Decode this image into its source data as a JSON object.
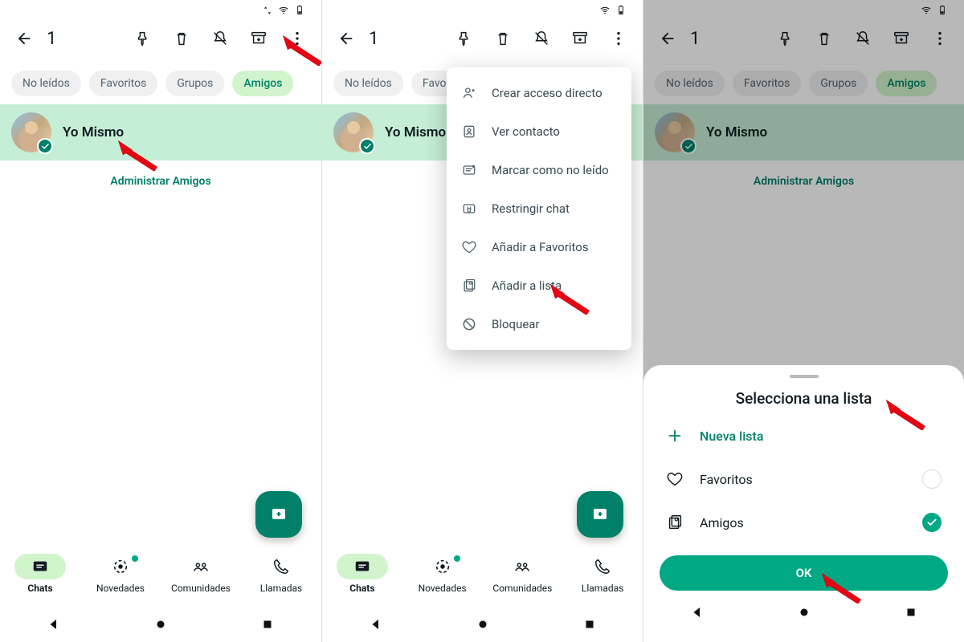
{
  "status": {
    "wifi": true,
    "battery": true
  },
  "appbar": {
    "count": "1",
    "icons": [
      "back",
      "pin",
      "delete",
      "mute",
      "archive",
      "more"
    ]
  },
  "chips": [
    {
      "label": "No leídos",
      "active": false
    },
    {
      "label": "Favoritos",
      "active": false
    },
    {
      "label": "Grupos",
      "active": false
    },
    {
      "label": "Amigos",
      "active": true
    }
  ],
  "chat": {
    "name": "Yo Mismo"
  },
  "manage": "Administrar Amigos",
  "bnav": [
    {
      "label": "Chats",
      "icon": "chat",
      "active": true
    },
    {
      "label": "Novedades",
      "icon": "status",
      "dot": true
    },
    {
      "label": "Comunidades",
      "icon": "communities"
    },
    {
      "label": "Llamadas",
      "icon": "calls"
    }
  ],
  "menu": [
    {
      "icon": "person-add",
      "label": "Crear acceso directo"
    },
    {
      "icon": "contact",
      "label": "Ver contacto"
    },
    {
      "icon": "unread",
      "label": "Marcar como no leído"
    },
    {
      "icon": "restrict",
      "label": "Restringir chat"
    },
    {
      "icon": "heart",
      "label": "Añadir a Favoritos"
    },
    {
      "icon": "list-add",
      "label": "Añadir a lista"
    },
    {
      "icon": "block",
      "label": "Bloquear"
    }
  ],
  "sheet": {
    "title": "Selecciona una lista",
    "new": "Nueva lista",
    "items": [
      {
        "icon": "heart",
        "label": "Favoritos",
        "checked": false
      },
      {
        "icon": "list",
        "label": "Amigos",
        "checked": true
      }
    ],
    "ok": "OK"
  }
}
